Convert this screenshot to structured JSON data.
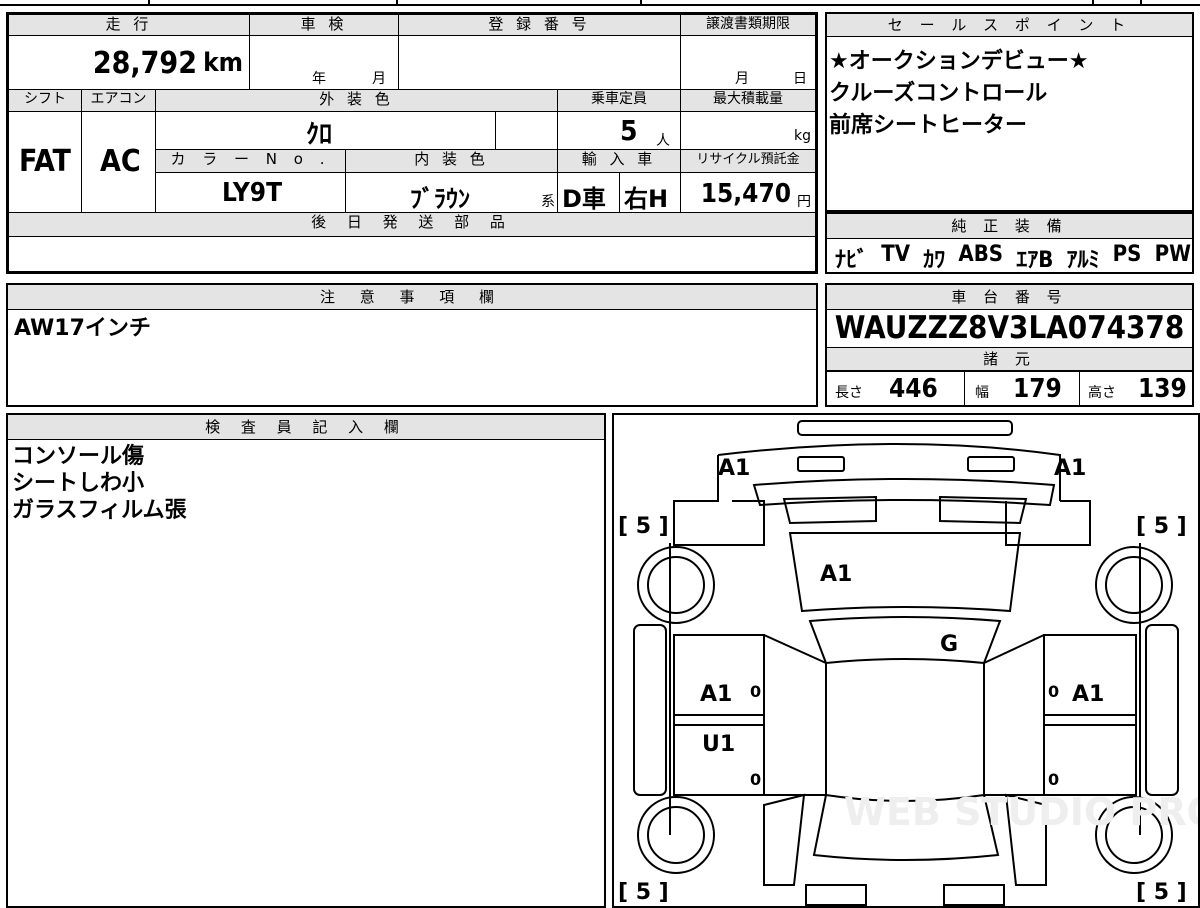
{
  "spec": {
    "headers": {
      "mileage": "走 行",
      "inspection": "車 検",
      "reg_no": "登 録 番 号",
      "transfer_deadline": "譲渡書類期限",
      "shift": "シフト",
      "aircon": "エアコン",
      "exterior_color": "外 装 色",
      "capacity": "乗車定員",
      "max_load": "最大積載量",
      "color_no": "カ ラ ー N o .",
      "interior_color": "内 装 色",
      "import": "輸 入 車",
      "recycle": "リサイクル預託金",
      "later_parts": "後 日 発 送 部 品"
    },
    "mileage_value": "28,792",
    "mileage_unit": "km",
    "year_label": "年",
    "month_label": "月",
    "deadline_month": "月",
    "deadline_day": "日",
    "shift_value": "FAT",
    "aircon_value": "AC",
    "exterior_color_value": "ｸﾛ",
    "capacity_value": "5",
    "capacity_unit": "人",
    "load_unit": "kg",
    "color_no_value": "LY9T",
    "interior_color_value": "ﾌﾞﾗｳﾝ",
    "interior_suffix": "系",
    "import_value_1": "D車",
    "import_value_2": "右H",
    "recycle_value": "15,470",
    "recycle_unit": "円"
  },
  "sales": {
    "header": "セ ー ル ス ポ イ ン ト",
    "lines": [
      "★オークションデビュー★",
      "クルーズコントロール",
      "前席シートヒーター"
    ]
  },
  "equipment": {
    "header": "純 正 装 備",
    "items": [
      "ﾅﾋﾞ",
      "TV",
      "ｶﾜ",
      "ABS",
      "ｴｱB",
      "ｱﾙﾐ",
      "PS",
      "PW"
    ]
  },
  "notes": {
    "header": "注 意 事 項 欄",
    "text": "AW17インチ"
  },
  "chassis": {
    "header": "車 台 番 号",
    "value": "WAUZZZ8V3LA074378",
    "dims_header": "諸 元",
    "length_label": "長さ",
    "length_value": "446",
    "width_label": "幅",
    "width_value": "179",
    "height_label": "高さ",
    "height_value": "139"
  },
  "inspector": {
    "header": "検 査 員 記 入 欄",
    "lines": [
      "コンソール傷",
      "シートしわ小",
      "ガラスフィルム張"
    ]
  },
  "diagram": {
    "marks": [
      "A1",
      "A1",
      "A1",
      "G",
      "A1",
      "U1",
      "A1"
    ],
    "tire_marks": [
      "[ 5 ]",
      "[ 5 ]",
      "[ 5 ]",
      "[ 5 ]"
    ],
    "zero_marks": [
      "0",
      "0",
      "0",
      "0"
    ],
    "watermark": "WEB STUDIO PRO"
  }
}
